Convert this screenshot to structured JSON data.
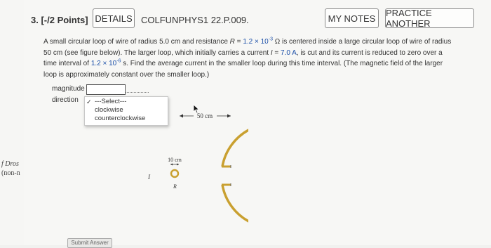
{
  "edge": {
    "line1": "f Dros",
    "line2": "(non-n"
  },
  "header": {
    "question_number": "3. [-/2 Points]",
    "details_label": "DETAILS",
    "problem_code": "COLFUNPHYS1 22.P.009.",
    "my_notes_label": "MY NOTES",
    "practice_label": "PRACTICE ANOTHER"
  },
  "problem": {
    "line1_a": "A small circular loop of wire of radius 5.0 cm and resistance ",
    "line1_r": "R",
    "line1_eq": " = ",
    "line1_val": "1.2 × 10",
    "line1_exp": "-3",
    "line1_b": " Ω is centered inside a large circular loop of wire of radius",
    "line2_a": "50 cm (see figure below). The larger loop, which initially carries a current ",
    "line2_i": "I",
    "line2_eq": " = ",
    "line2_val": "7.0 A",
    "line2_b": ", is cut and its current is reduced to zero over a",
    "line3_a": "time interval of ",
    "line3_val": "1.2 × 10",
    "line3_exp": "-6",
    "line3_b": " s. Find the average current in the smaller loop during this time interval. (The magnetic field of the larger",
    "line4": "loop is approximately constant over the smaller loop.)"
  },
  "answers": {
    "magnitude_label": "magnitude",
    "direction_label": "direction",
    "magnitude_value": "",
    "dropdown_options": [
      "---Select---",
      "clockwise",
      "counterclockwise"
    ],
    "selected_index": 0
  },
  "figure": {
    "big_label": "50 cm",
    "small_label": "10 cm",
    "current_label": "I",
    "resistance_label": "R",
    "wire_color": "#c9a030"
  },
  "submit_label": "Submit Answer"
}
